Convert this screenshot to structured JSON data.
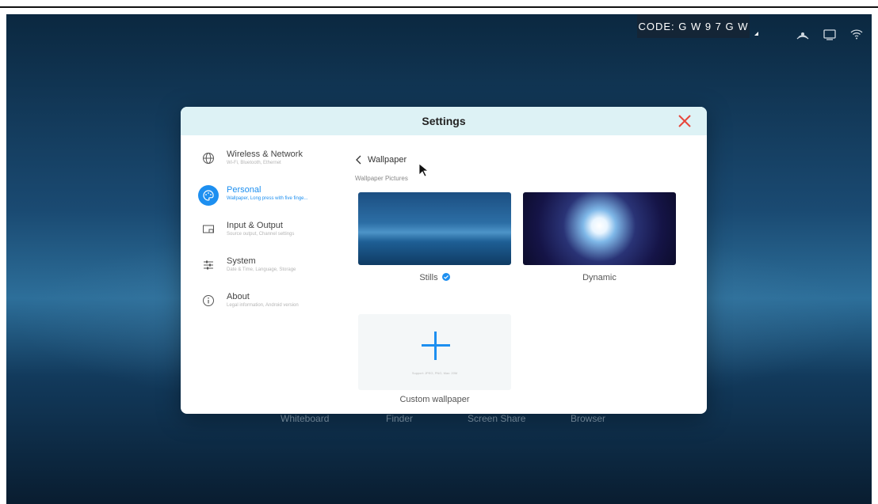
{
  "statusbar": {
    "code": "CODE: G W 9 7 G W"
  },
  "dock": {
    "items": [
      "Whiteboard",
      "Finder",
      "Screen Share",
      "Browser"
    ]
  },
  "dialog": {
    "title": "Settings",
    "sidebar": [
      {
        "label": "Wireless & Network",
        "sub": "Wi-Fi, Bluetooth, Ethernet",
        "icon": "globe-icon"
      },
      {
        "label": "Personal",
        "sub": "Wallpaper, Long press with five finge...",
        "icon": "palette-icon",
        "active": true
      },
      {
        "label": "Input & Output",
        "sub": "Source output, Channel settings",
        "icon": "input-output-icon"
      },
      {
        "label": "System",
        "sub": "Date & Time, Language, Storage",
        "icon": "sliders-icon"
      },
      {
        "label": "About",
        "sub": "Legal information, Android version",
        "icon": "info-icon"
      }
    ],
    "main": {
      "back_label": "Wallpaper",
      "section_label": "Wallpaper Pictures",
      "cards": [
        {
          "label": "Stills",
          "selected": true
        },
        {
          "label": "Dynamic",
          "selected": false
        }
      ],
      "custom": {
        "label": "Custom wallpaper",
        "hint": "Support: JPEG, PNG, Max: 20M"
      }
    }
  },
  "colors": {
    "accent": "#1d8ff0",
    "header_bg": "#ddf2f5",
    "close": "#e8463b"
  }
}
